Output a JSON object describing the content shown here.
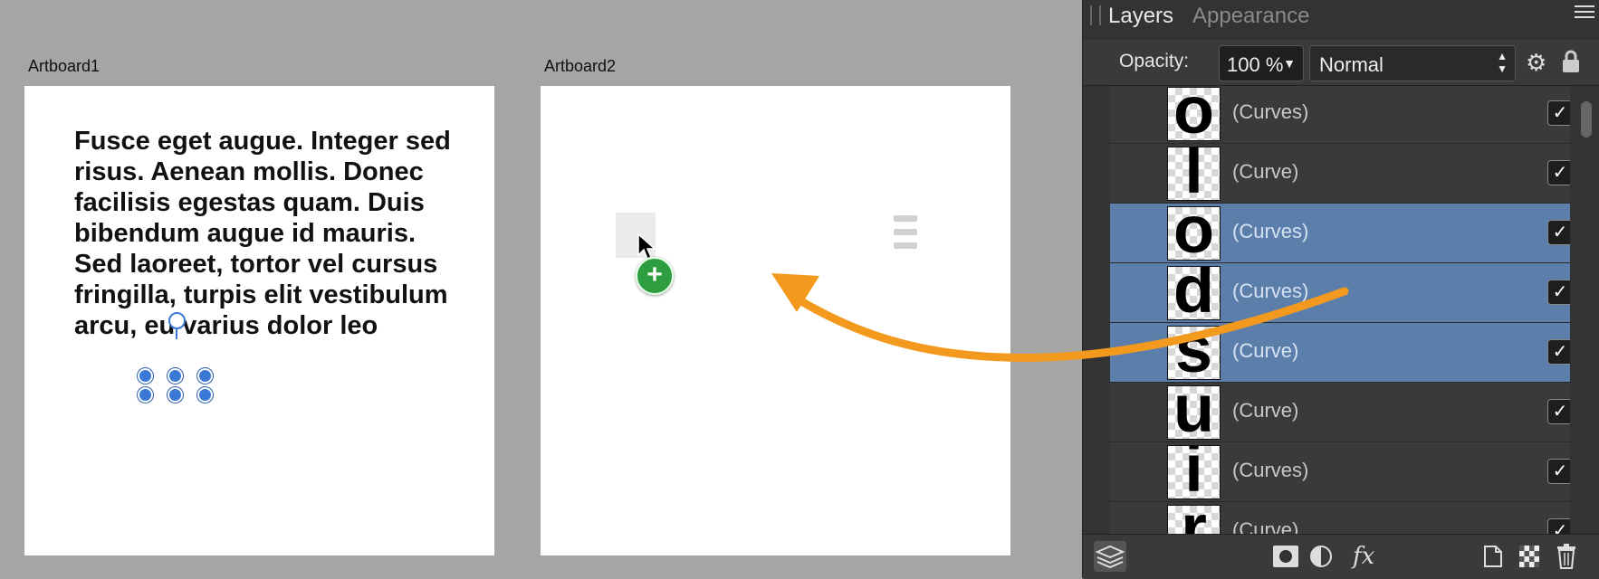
{
  "canvas": {
    "artboard1": {
      "label": "Artboard1",
      "text": "Fusce eget augue. Integer sed risus. Aenean mollis. Donec facilisis egestas quam. Duis bibendum augue  id mauris. Sed laoreet, tortor vel cursus fringilla, turpis elit vestibulum arcu, eu varius dolor leo"
    },
    "artboard2": {
      "label": "Artboard2"
    },
    "drag_badge": "+"
  },
  "panel": {
    "tabs": [
      {
        "label": "Layers",
        "active": true
      },
      {
        "label": "Appearance",
        "active": false
      }
    ],
    "opacity_label": "Opacity:",
    "opacity_value": "100 %",
    "blend_mode": "Normal",
    "layers": [
      {
        "glyph": "o",
        "name": "(Curves)",
        "selected": false,
        "visible": true
      },
      {
        "glyph": "l",
        "name": "(Curve)",
        "selected": false,
        "visible": true
      },
      {
        "glyph": "o",
        "name": "(Curves)",
        "selected": true,
        "visible": true
      },
      {
        "glyph": "d",
        "name": "(Curves)",
        "selected": true,
        "visible": true
      },
      {
        "glyph": "s",
        "name": "(Curve)",
        "selected": true,
        "visible": true
      },
      {
        "glyph": "u",
        "name": "(Curve)",
        "selected": false,
        "visible": true
      },
      {
        "glyph": "i",
        "name": "(Curves)",
        "selected": false,
        "visible": true
      },
      {
        "glyph": "r",
        "name": "(Curve)",
        "selected": false,
        "visible": true
      }
    ],
    "check_glyph": "✓"
  },
  "icons": {
    "layers_stack": "layers-stack-icon",
    "mask": "mask-icon",
    "adjustment": "adjustment-icon",
    "fx": "fx",
    "new_layer": "new-layer-icon",
    "pixel_layer": "pixel-layer-icon",
    "trash": "trash-icon"
  },
  "colors": {
    "selection": "#5b7eab",
    "accent_arrow": "#f39a1e",
    "handle": "#3a78d6",
    "add_badge": "#2e9d3f"
  }
}
